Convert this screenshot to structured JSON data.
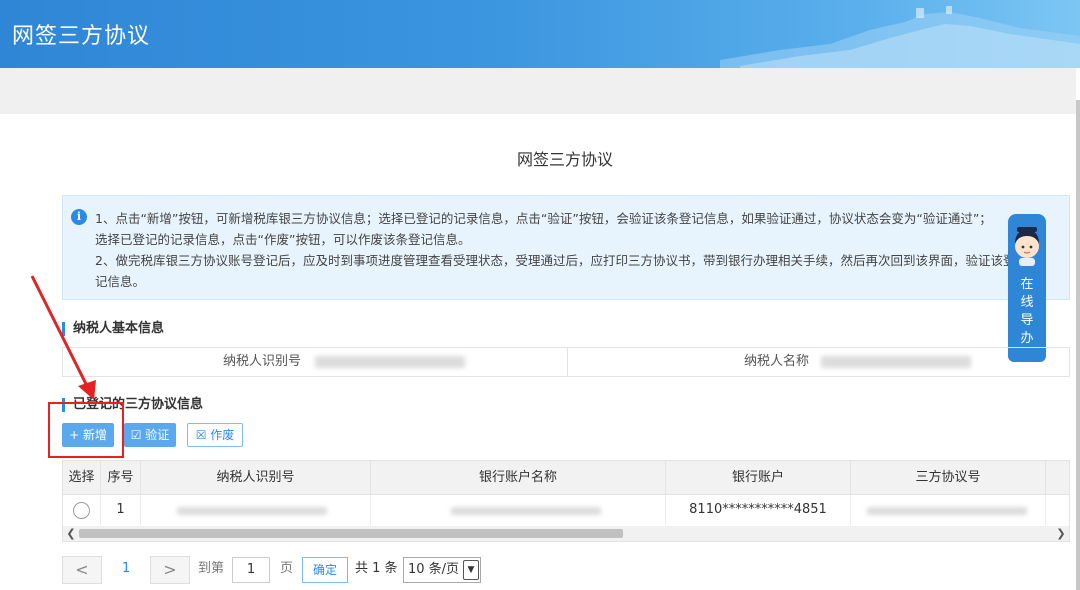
{
  "header": {
    "title": "网签三方协议"
  },
  "page": {
    "title": "网签三方协议"
  },
  "notice": {
    "icon": "info-icon",
    "lines": [
      "1、点击“新增”按钮，可新增税库银三方协议信息；选择已登记的记录信息，点击“验证”按钮，会验证该条登记信息，如果验证通过，协议状态会变为“验证通过”；",
      "选择已登记的记录信息，点击“作废”按钮，可以作废该条登记信息。",
      "2、做完税库银三方协议账号登记后，应及时到事项进度管理查看受理状态，受理通过后，应打印三方协议书，带到银行办理相关手续，然后再次回到该界面，验证该登",
      "记信息。"
    ]
  },
  "taxpayer_section": {
    "title": "纳税人基本信息",
    "id_label": "纳税人识别号",
    "name_label": "纳税人名称"
  },
  "agreements_section": {
    "title": "已登记的三方协议信息",
    "add_label": "+ 新增",
    "verify_label": "☑ 验证",
    "void_label": "☒ 作废"
  },
  "table": {
    "columns": [
      "选择",
      "序号",
      "纳税人识别号",
      "银行账户名称",
      "银行账户",
      "三方协议号"
    ],
    "rows": [
      {
        "index": "1",
        "bank_account": "8110***********4851"
      }
    ]
  },
  "pagination": {
    "prev": "<",
    "current_page": "1",
    "next": ">",
    "goto_label": "到第",
    "goto_value": "1",
    "page_unit": "页",
    "confirm_label": "确定",
    "total_label": "共 1 条",
    "page_size": "10 条/页"
  },
  "float_guide": {
    "label_chars": [
      "在",
      "线",
      "导",
      "办"
    ]
  },
  "colors": {
    "brand_blue": "#2b8ae6",
    "header_blue": "#2f86d6",
    "highlight_red": "#e52222"
  }
}
